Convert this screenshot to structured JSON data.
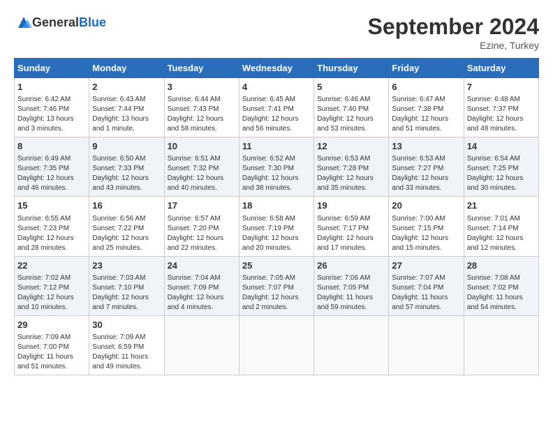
{
  "header": {
    "logo_general": "General",
    "logo_blue": "Blue",
    "month_title": "September 2024",
    "subtitle": "Ezine, Turkey"
  },
  "weekdays": [
    "Sunday",
    "Monday",
    "Tuesday",
    "Wednesday",
    "Thursday",
    "Friday",
    "Saturday"
  ],
  "weeks": [
    [
      {
        "day": "1",
        "info": "Sunrise: 6:42 AM\nSunset: 7:46 PM\nDaylight: 13 hours\nand 3 minutes."
      },
      {
        "day": "2",
        "info": "Sunrise: 6:43 AM\nSunset: 7:44 PM\nDaylight: 13 hours\nand 1 minute."
      },
      {
        "day": "3",
        "info": "Sunrise: 6:44 AM\nSunset: 7:43 PM\nDaylight: 12 hours\nand 58 minutes."
      },
      {
        "day": "4",
        "info": "Sunrise: 6:45 AM\nSunset: 7:41 PM\nDaylight: 12 hours\nand 56 minutes."
      },
      {
        "day": "5",
        "info": "Sunrise: 6:46 AM\nSunset: 7:40 PM\nDaylight: 12 hours\nand 53 minutes."
      },
      {
        "day": "6",
        "info": "Sunrise: 6:47 AM\nSunset: 7:38 PM\nDaylight: 12 hours\nand 51 minutes."
      },
      {
        "day": "7",
        "info": "Sunrise: 6:48 AM\nSunset: 7:37 PM\nDaylight: 12 hours\nand 48 minutes."
      }
    ],
    [
      {
        "day": "8",
        "info": "Sunrise: 6:49 AM\nSunset: 7:35 PM\nDaylight: 12 hours\nand 46 minutes."
      },
      {
        "day": "9",
        "info": "Sunrise: 6:50 AM\nSunset: 7:33 PM\nDaylight: 12 hours\nand 43 minutes."
      },
      {
        "day": "10",
        "info": "Sunrise: 6:51 AM\nSunset: 7:32 PM\nDaylight: 12 hours\nand 40 minutes."
      },
      {
        "day": "11",
        "info": "Sunrise: 6:52 AM\nSunset: 7:30 PM\nDaylight: 12 hours\nand 38 minutes."
      },
      {
        "day": "12",
        "info": "Sunrise: 6:53 AM\nSunset: 7:28 PM\nDaylight: 12 hours\nand 35 minutes."
      },
      {
        "day": "13",
        "info": "Sunrise: 6:53 AM\nSunset: 7:27 PM\nDaylight: 12 hours\nand 33 minutes."
      },
      {
        "day": "14",
        "info": "Sunrise: 6:54 AM\nSunset: 7:25 PM\nDaylight: 12 hours\nand 30 minutes."
      }
    ],
    [
      {
        "day": "15",
        "info": "Sunrise: 6:55 AM\nSunset: 7:23 PM\nDaylight: 12 hours\nand 28 minutes."
      },
      {
        "day": "16",
        "info": "Sunrise: 6:56 AM\nSunset: 7:22 PM\nDaylight: 12 hours\nand 25 minutes."
      },
      {
        "day": "17",
        "info": "Sunrise: 6:57 AM\nSunset: 7:20 PM\nDaylight: 12 hours\nand 22 minutes."
      },
      {
        "day": "18",
        "info": "Sunrise: 6:58 AM\nSunset: 7:19 PM\nDaylight: 12 hours\nand 20 minutes."
      },
      {
        "day": "19",
        "info": "Sunrise: 6:59 AM\nSunset: 7:17 PM\nDaylight: 12 hours\nand 17 minutes."
      },
      {
        "day": "20",
        "info": "Sunrise: 7:00 AM\nSunset: 7:15 PM\nDaylight: 12 hours\nand 15 minutes."
      },
      {
        "day": "21",
        "info": "Sunrise: 7:01 AM\nSunset: 7:14 PM\nDaylight: 12 hours\nand 12 minutes."
      }
    ],
    [
      {
        "day": "22",
        "info": "Sunrise: 7:02 AM\nSunset: 7:12 PM\nDaylight: 12 hours\nand 10 minutes."
      },
      {
        "day": "23",
        "info": "Sunrise: 7:03 AM\nSunset: 7:10 PM\nDaylight: 12 hours\nand 7 minutes."
      },
      {
        "day": "24",
        "info": "Sunrise: 7:04 AM\nSunset: 7:09 PM\nDaylight: 12 hours\nand 4 minutes."
      },
      {
        "day": "25",
        "info": "Sunrise: 7:05 AM\nSunset: 7:07 PM\nDaylight: 12 hours\nand 2 minutes."
      },
      {
        "day": "26",
        "info": "Sunrise: 7:06 AM\nSunset: 7:05 PM\nDaylight: 11 hours\nand 59 minutes."
      },
      {
        "day": "27",
        "info": "Sunrise: 7:07 AM\nSunset: 7:04 PM\nDaylight: 11 hours\nand 57 minutes."
      },
      {
        "day": "28",
        "info": "Sunrise: 7:08 AM\nSunset: 7:02 PM\nDaylight: 11 hours\nand 54 minutes."
      }
    ],
    [
      {
        "day": "29",
        "info": "Sunrise: 7:09 AM\nSunset: 7:00 PM\nDaylight: 11 hours\nand 51 minutes."
      },
      {
        "day": "30",
        "info": "Sunrise: 7:09 AM\nSunset: 6:59 PM\nDaylight: 11 hours\nand 49 minutes."
      },
      null,
      null,
      null,
      null,
      null
    ]
  ]
}
